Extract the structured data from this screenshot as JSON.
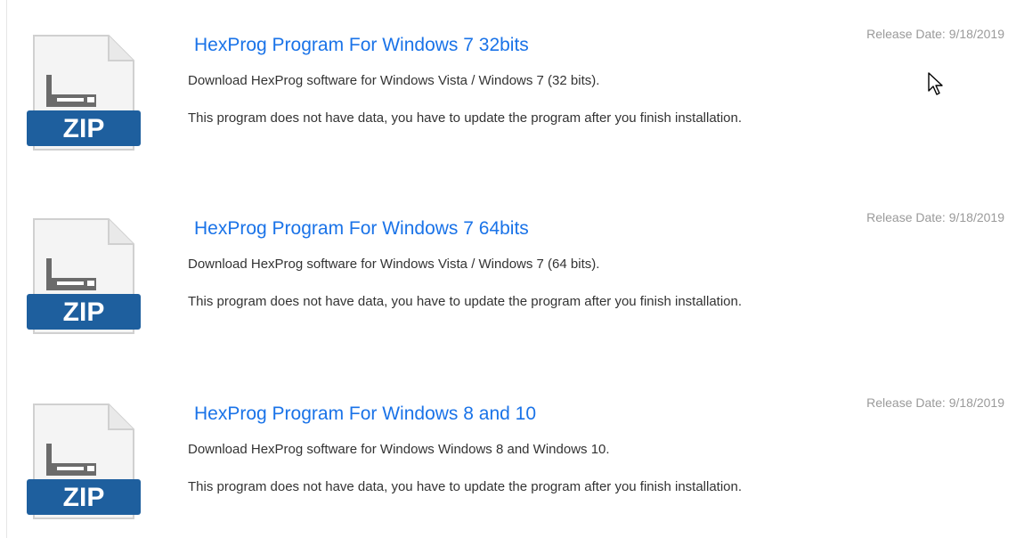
{
  "downloads": [
    {
      "title": "HexProg Program For Windows 7 32bits",
      "description": "Download HexProg software for Windows Vista / Windows 7 (32 bits).",
      "note": "This program does not have data, you have to update the program after you finish installation.",
      "release_date": "Release Date: 9/18/2019",
      "icon": "zip-file-icon",
      "icon_label": "ZIP"
    },
    {
      "title": "HexProg Program For Windows 7 64bits",
      "description": "Download HexProg software for Windows Vista / Windows 7 (64 bits).",
      "note": "This program does not have data, you have to update the program after you finish installation.",
      "release_date": "Release Date: 9/18/2019",
      "icon": "zip-file-icon",
      "icon_label": "ZIP"
    },
    {
      "title": "HexProg Program For Windows 8 and 10",
      "description": "Download HexProg software for Windows Windows 8 and Windows 10.",
      "note": "This program does not have data, you have to update the program after you finish installation.",
      "release_date": "Release Date: 9/18/2019",
      "icon": "zip-file-icon",
      "icon_label": "ZIP"
    }
  ],
  "colors": {
    "link": "#1a73e8",
    "body_text": "#333333",
    "date_text": "#9a9a9a",
    "zip_band": "#1e5f9e"
  }
}
